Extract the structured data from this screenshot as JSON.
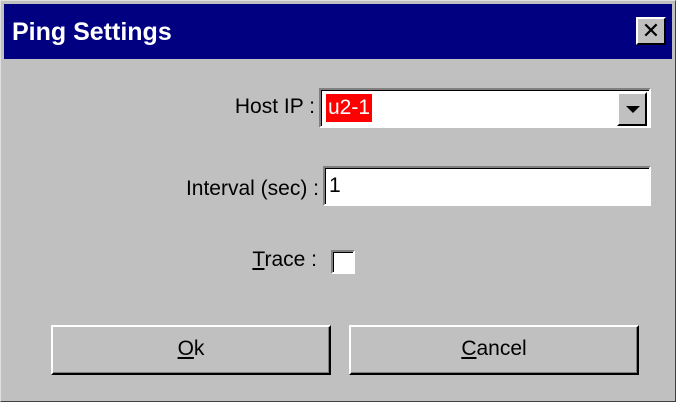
{
  "window": {
    "title": "Ping Settings",
    "close_glyph": "✕"
  },
  "form": {
    "host_ip": {
      "label_prefix": "Host IP",
      "label_suffix": " :",
      "value": "u2-1"
    },
    "interval": {
      "label": "Interval (sec) :",
      "value": "1"
    },
    "trace": {
      "label_underlined": "T",
      "label_rest": "race :",
      "checked": false
    }
  },
  "buttons": {
    "ok": {
      "underlined": "O",
      "rest": "k"
    },
    "cancel": {
      "underlined": "C",
      "rest": "ancel"
    }
  },
  "colors": {
    "titlebar": "#000080",
    "dialog_bg": "#c0c0c0",
    "selection": "#ff0000"
  }
}
